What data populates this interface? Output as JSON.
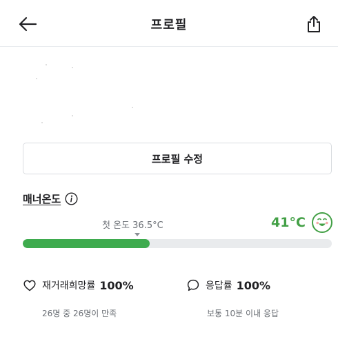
{
  "header": {
    "title": "프로필",
    "back_icon": "arrow-left-icon",
    "share_icon": "share-icon"
  },
  "profile": {
    "edit_button_label": "프로필 수정"
  },
  "manner": {
    "label": "매너온도",
    "info_icon": "info-icon",
    "first_temp_label": "첫 온도 36.5°C",
    "temperature": "41°C",
    "temperature_level": 0.41,
    "face_icon": "smile-face-icon",
    "accent_color": "#43a046",
    "bar_color": "#3eab4e"
  },
  "stats": [
    {
      "icon": "heart-icon",
      "label": "재거래희망률",
      "value": "100%",
      "sub": "26명 중 26명이 만족"
    },
    {
      "icon": "chat-bubble-icon",
      "label": "응답률",
      "value": "100%",
      "sub": "보통 10분 이내 응답"
    }
  ]
}
